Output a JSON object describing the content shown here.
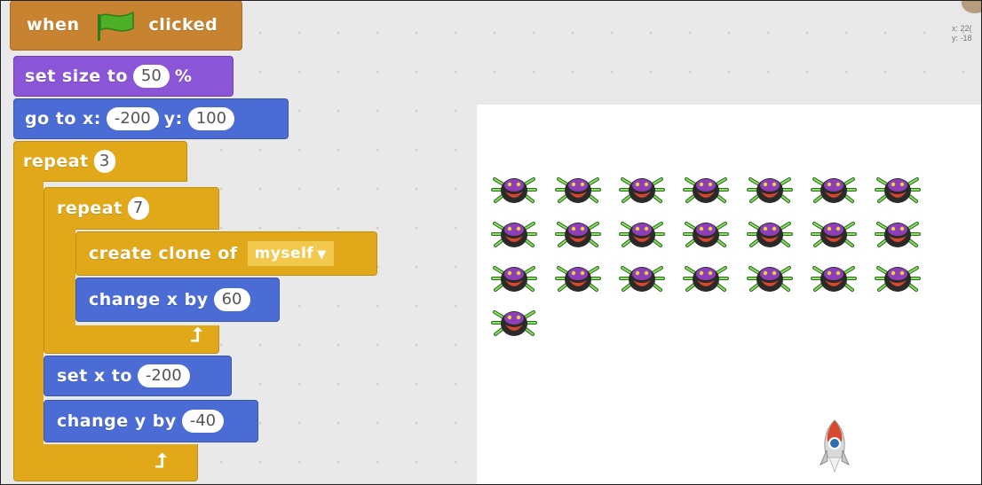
{
  "script": {
    "hat": {
      "prefix": "when",
      "suffix": "clicked",
      "icon": "green-flag-icon"
    },
    "set_size": {
      "label": "set size to",
      "value": "50",
      "unit": "%"
    },
    "go_to": {
      "label_x": "go to x:",
      "x": "-200",
      "label_y": "y:",
      "y": "100"
    },
    "repeat_outer": {
      "label": "repeat",
      "count": "3"
    },
    "repeat_inner": {
      "label": "repeat",
      "count": "7"
    },
    "create_clone": {
      "label": "create clone of",
      "target": "myself"
    },
    "change_x": {
      "label": "change x by",
      "value": "60"
    },
    "set_x": {
      "label": "set x to",
      "value": "-200"
    },
    "change_y": {
      "label": "change y by",
      "value": "-40"
    }
  },
  "coords": {
    "x": "x: 22(",
    "y": "y: -18"
  },
  "stage": {
    "clone_count": 22,
    "clones_per_row": 7,
    "sprite": "beetle-icon",
    "player": "rocket-icon"
  },
  "colors": {
    "events": "#c88330",
    "looks": "#8a55d7",
    "motion": "#4a6cd4",
    "control": "#e1a91a"
  }
}
